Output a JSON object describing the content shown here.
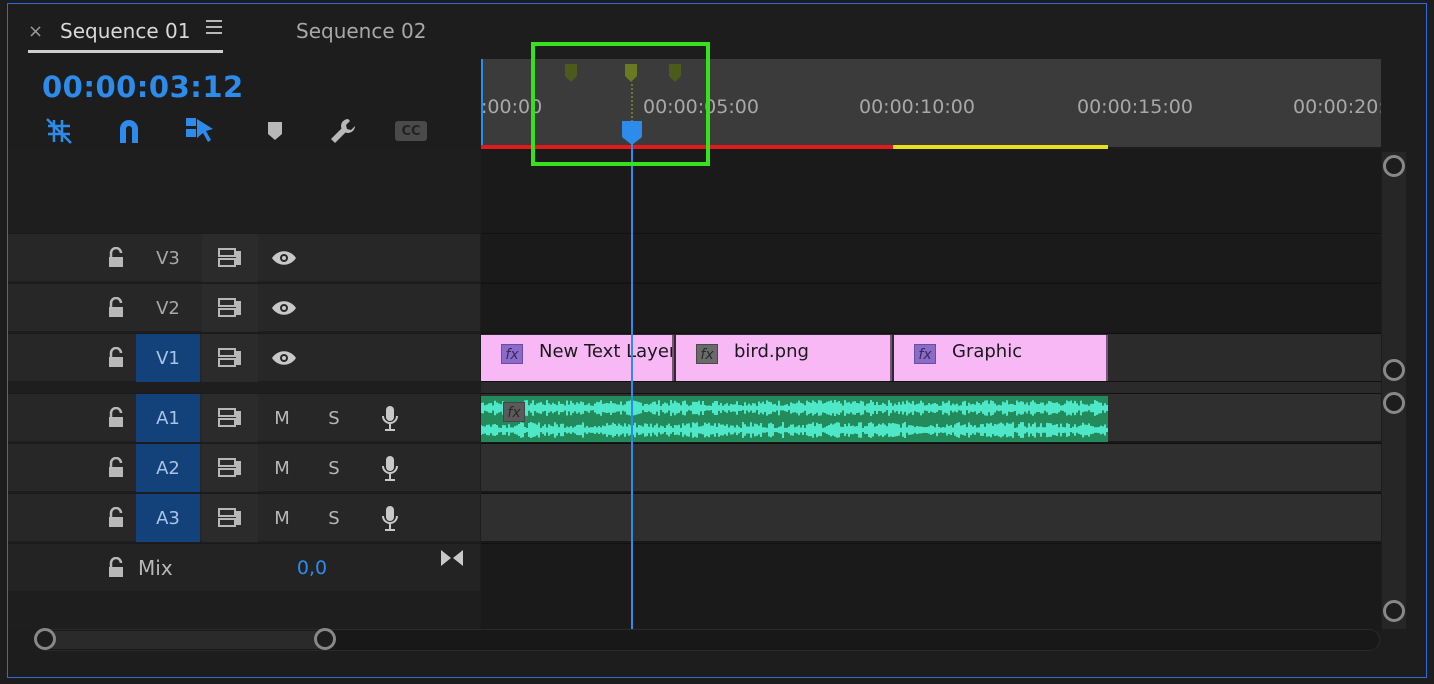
{
  "tabs": [
    {
      "label": "Sequence 01",
      "active": true
    },
    {
      "label": "Sequence 02",
      "active": false
    }
  ],
  "tab_close_icon": "×",
  "timecode": "00:00:03:12",
  "tools": [
    "snap-toggle-icon",
    "magnet-icon",
    "linked-selection-icon",
    "add-marker-icon",
    "wrench-icon",
    "closed-captions-icon"
  ],
  "tools_cc_label": "CC",
  "ruler": {
    "labels": [
      ":00:00",
      "00:00:05:00",
      "00:00:10:00",
      "00:00:15:00",
      "00:00:20:"
    ]
  },
  "tracks": {
    "video": [
      {
        "name": "V3",
        "targeted": false
      },
      {
        "name": "V2",
        "targeted": false
      },
      {
        "name": "V1",
        "targeted": true
      }
    ],
    "audio": [
      {
        "name": "A1",
        "targeted": true,
        "mute": "M",
        "solo": "S"
      },
      {
        "name": "A2",
        "targeted": true,
        "mute": "M",
        "solo": "S"
      },
      {
        "name": "A3",
        "targeted": true,
        "mute": "M",
        "solo": "S"
      }
    ],
    "mix": {
      "label": "Mix",
      "value": "0,0"
    }
  },
  "clips": {
    "v1": [
      {
        "name": "New Text Layer",
        "fx_color": "purple"
      },
      {
        "name": "bird.png",
        "fx_color": "gray"
      },
      {
        "name": "Graphic",
        "fx_color": "purple"
      }
    ],
    "fx_label": "fx"
  },
  "colors": {
    "accent": "#2d8ceb",
    "clip_video": "#f8b8f6",
    "clip_audio": "#238a5c",
    "waveform": "#4ee8c8",
    "render_red": "#e01b1b",
    "render_yellow": "#e8e01a",
    "highlight": "#38e01e"
  }
}
